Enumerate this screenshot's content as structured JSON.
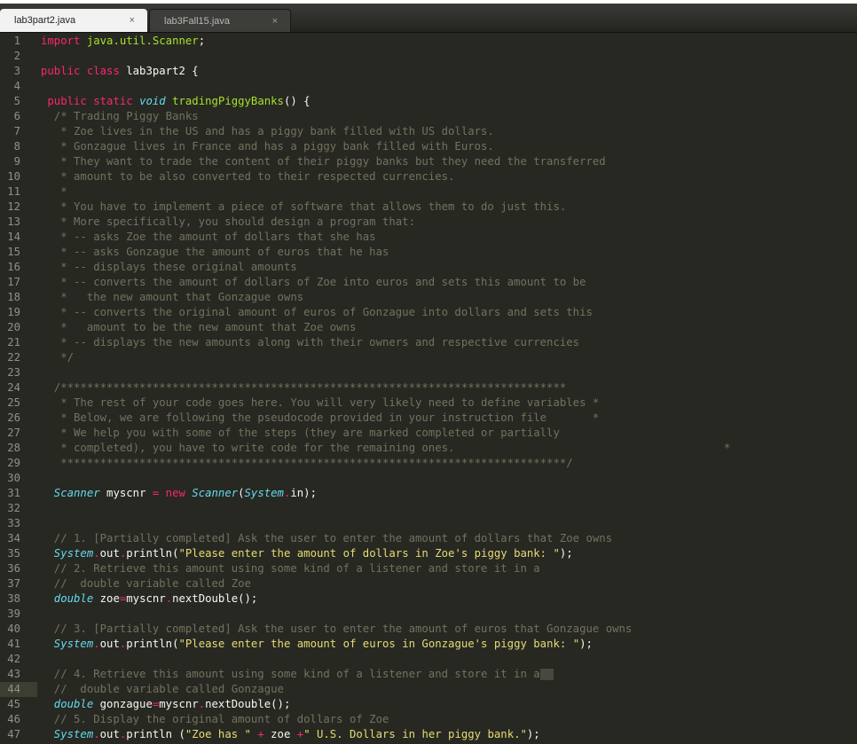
{
  "tabs": [
    {
      "label": "lab3part2.java",
      "close": "×"
    },
    {
      "label": "lab3Fall15.java",
      "close": "×"
    }
  ],
  "lines": [
    {
      "n": "1",
      "tokens": [
        [
          "k",
          "import "
        ],
        [
          "f",
          "java.util.Scanner"
        ],
        [
          "p",
          ";"
        ]
      ]
    },
    {
      "n": "2",
      "tokens": []
    },
    {
      "n": "3",
      "tokens": [
        [
          "k",
          "public "
        ],
        [
          "k",
          "class "
        ],
        [
          "p",
          "lab3part2 {"
        ]
      ]
    },
    {
      "n": "4",
      "tokens": []
    },
    {
      "n": "5",
      "tokens": [
        [
          "k",
          " public "
        ],
        [
          "k",
          "static "
        ],
        [
          "t",
          "void "
        ],
        [
          "f",
          "tradingPiggyBanks"
        ],
        [
          "p",
          "() {"
        ]
      ]
    },
    {
      "n": "6",
      "tokens": [
        [
          "c",
          "  /* Trading Piggy Banks"
        ]
      ]
    },
    {
      "n": "7",
      "tokens": [
        [
          "c",
          "   * Zoe lives in the US and has a piggy bank filled with US dollars."
        ]
      ]
    },
    {
      "n": "8",
      "tokens": [
        [
          "c",
          "   * Gonzague lives in France and has a piggy bank filled with Euros."
        ]
      ]
    },
    {
      "n": "9",
      "tokens": [
        [
          "c",
          "   * They want to trade the content of their piggy banks but they need the transferred"
        ]
      ]
    },
    {
      "n": "10",
      "tokens": [
        [
          "c",
          "   * amount to be also converted to their respected currencies."
        ]
      ]
    },
    {
      "n": "11",
      "tokens": [
        [
          "c",
          "   *"
        ]
      ]
    },
    {
      "n": "12",
      "tokens": [
        [
          "c",
          "   * You have to implement a piece of software that allows them to do just this."
        ]
      ]
    },
    {
      "n": "13",
      "tokens": [
        [
          "c",
          "   * More specifically, you should design a program that:"
        ]
      ]
    },
    {
      "n": "14",
      "tokens": [
        [
          "c",
          "   * -- asks Zoe the amount of dollars that she has"
        ]
      ]
    },
    {
      "n": "15",
      "tokens": [
        [
          "c",
          "   * -- asks Gonzague the amount of euros that he has"
        ]
      ]
    },
    {
      "n": "16",
      "tokens": [
        [
          "c",
          "   * -- displays these original amounts"
        ]
      ]
    },
    {
      "n": "17",
      "tokens": [
        [
          "c",
          "   * -- converts the amount of dollars of Zoe into euros and sets this amount to be"
        ]
      ]
    },
    {
      "n": "18",
      "tokens": [
        [
          "c",
          "   *   the new amount that Gonzague owns"
        ]
      ]
    },
    {
      "n": "19",
      "tokens": [
        [
          "c",
          "   * -- converts the original amount of euros of Gonzague into dollars and sets this"
        ]
      ]
    },
    {
      "n": "20",
      "tokens": [
        [
          "c",
          "   *   amount to be the new amount that Zoe owns"
        ]
      ]
    },
    {
      "n": "21",
      "tokens": [
        [
          "c",
          "   * -- displays the new amounts along with their owners and respective currencies"
        ]
      ]
    },
    {
      "n": "22",
      "tokens": [
        [
          "c",
          "   */"
        ]
      ]
    },
    {
      "n": "23",
      "tokens": []
    },
    {
      "n": "24",
      "tokens": [
        [
          "c",
          "  /*****************************************************************************"
        ]
      ]
    },
    {
      "n": "25",
      "tokens": [
        [
          "c",
          "   * The rest of your code goes here. You will very likely need to define variables *"
        ]
      ]
    },
    {
      "n": "26",
      "tokens": [
        [
          "c",
          "   * Below, we are following the pseudocode provided in your instruction file       *"
        ]
      ]
    },
    {
      "n": "27",
      "tokens": [
        [
          "c",
          "   * We help you with some of the steps (they are marked completed or partially"
        ]
      ]
    },
    {
      "n": "28",
      "tokens": [
        [
          "c",
          "   * completed), you have to write code for the remaining ones.                                         *"
        ]
      ]
    },
    {
      "n": "29",
      "tokens": [
        [
          "c",
          "   *****************************************************************************/"
        ]
      ]
    },
    {
      "n": "30",
      "tokens": []
    },
    {
      "n": "31",
      "tokens": [
        [
          "t",
          "  Scanner "
        ],
        [
          "p",
          "myscnr "
        ],
        [
          "k",
          "= new "
        ],
        [
          "t",
          "Scanner"
        ],
        [
          "p",
          "("
        ],
        [
          "t",
          "System"
        ],
        [
          "k",
          "."
        ],
        [
          "p",
          "in);"
        ]
      ]
    },
    {
      "n": "32",
      "tokens": []
    },
    {
      "n": "33",
      "tokens": []
    },
    {
      "n": "34",
      "tokens": [
        [
          "c",
          "  // 1. [Partially completed] Ask the user to enter the amount of dollars that Zoe owns"
        ]
      ]
    },
    {
      "n": "35",
      "tokens": [
        [
          "t",
          "  System"
        ],
        [
          "k",
          "."
        ],
        [
          "p",
          "out"
        ],
        [
          "k",
          "."
        ],
        [
          "p",
          "println("
        ],
        [
          "s",
          "\"Please enter the amount of dollars in Zoe's piggy bank: \""
        ],
        [
          "p",
          ");"
        ]
      ]
    },
    {
      "n": "36",
      "tokens": [
        [
          "c",
          "  // 2. Retrieve this amount using some kind of a listener and store it in a"
        ]
      ]
    },
    {
      "n": "37",
      "tokens": [
        [
          "c",
          "  //  double variable called Zoe"
        ]
      ]
    },
    {
      "n": "38",
      "tokens": [
        [
          "t",
          "  double "
        ],
        [
          "p",
          "zoe"
        ],
        [
          "k",
          "="
        ],
        [
          "p",
          "myscnr"
        ],
        [
          "k",
          "."
        ],
        [
          "p",
          "nextDouble();"
        ]
      ]
    },
    {
      "n": "39",
      "tokens": []
    },
    {
      "n": "40",
      "tokens": [
        [
          "c",
          "  // 3. [Partially completed] Ask the user to enter the amount of euros that Gonzague owns"
        ]
      ]
    },
    {
      "n": "41",
      "tokens": [
        [
          "t",
          "  System"
        ],
        [
          "k",
          "."
        ],
        [
          "p",
          "out"
        ],
        [
          "k",
          "."
        ],
        [
          "p",
          "println("
        ],
        [
          "s",
          "\"Please enter the amount of euros in Gonzague's piggy bank: \""
        ],
        [
          "p",
          ");"
        ]
      ]
    },
    {
      "n": "42",
      "tokens": []
    },
    {
      "n": "43",
      "tokens": [
        [
          "c",
          "  // 4. Retrieve this amount using some kind of a listener and store it in a"
        ]
      ]
    },
    {
      "n": "44",
      "tokens": [
        [
          "c",
          "  //  double variable called Gonzague"
        ]
      ]
    },
    {
      "n": "45",
      "tokens": [
        [
          "t",
          "  double "
        ],
        [
          "p",
          "gonzague"
        ],
        [
          "k",
          "="
        ],
        [
          "p",
          "myscnr"
        ],
        [
          "k",
          "."
        ],
        [
          "p",
          "nextDouble();"
        ]
      ]
    },
    {
      "n": "46",
      "tokens": [
        [
          "c",
          "  // 5. Display the original amount of dollars of Zoe"
        ]
      ]
    },
    {
      "n": "47",
      "tokens": [
        [
          "t",
          "  System"
        ],
        [
          "k",
          "."
        ],
        [
          "p",
          "out"
        ],
        [
          "k",
          "."
        ],
        [
          "p",
          "println ("
        ],
        [
          "s",
          "\"Zoe has \" "
        ],
        [
          "k",
          "+ "
        ],
        [
          "p",
          "zoe "
        ],
        [
          "k",
          "+"
        ],
        [
          "s",
          "\" U.S. Dollars in her piggy bank.\""
        ],
        [
          "p",
          ");"
        ]
      ]
    }
  ],
  "current_line": "44",
  "cursor_after_line": "43"
}
